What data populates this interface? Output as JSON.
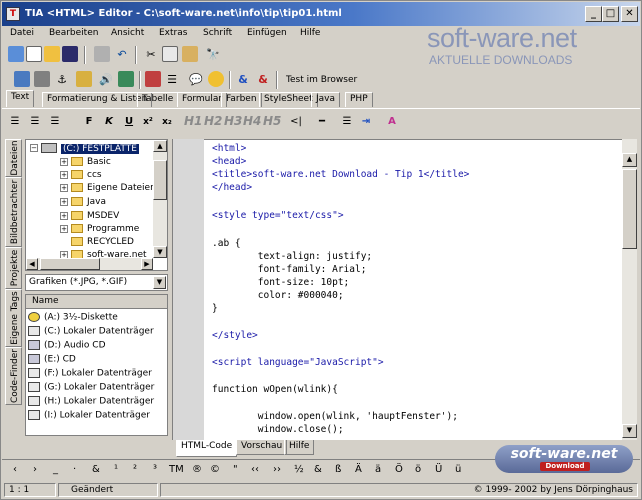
{
  "window": {
    "title": "TIA <HTML> Editor - C:\\soft-ware.net\\info\\tip\\tip01.html",
    "buttons": {
      "min": "_",
      "max": "□",
      "close": "✕"
    }
  },
  "menu": [
    "Datei",
    "Bearbeiten",
    "Ansicht",
    "Extras",
    "Schrift",
    "Einfügen",
    "Hilfe"
  ],
  "logo": {
    "title": "soft-ware.net",
    "subtitle": "AKTUELLE DOWNLOADS"
  },
  "toolbar2": {
    "browser_test_label": "Test im Browser"
  },
  "tabs": [
    "Text",
    "Formatierung & Listen",
    "Tabelle",
    "Formular",
    "Farben",
    "StyleSheet",
    "Java",
    "PHP"
  ],
  "format": {
    "bold": "F",
    "italic": "K",
    "underline": "U",
    "sup": "x²",
    "sub": "x₂",
    "headings": [
      "H1",
      "H2",
      "H3",
      "H4",
      "H5"
    ],
    "lt": "<|"
  },
  "side_tabs": [
    "Dateien",
    "Bildbetrachter",
    "Projekte",
    "Eigene Tags",
    "Code-Finder"
  ],
  "tree": {
    "root": "(C:) FESTPLATTE",
    "items": [
      "Basic",
      "ccs",
      "Eigene Dateien",
      "Java",
      "MSDEV",
      "Programme",
      "RECYCLED",
      "soft-ware.net"
    ]
  },
  "filter": {
    "value": "Grafiken (*.JPG, *.GIF)"
  },
  "files": {
    "header": "Name",
    "rows": [
      "(A:) 3½-Diskette",
      "(C:) Lokaler Datenträger",
      "(D:) Audio CD",
      "(E:) CD",
      "(F:) Lokaler Datenträger",
      "(G:) Lokaler Datenträger",
      "(H:) Lokaler Datenträger",
      "(I:) Lokaler Datenträger"
    ]
  },
  "code": [
    "<html>",
    "<head>",
    "<title>soft-ware.net Download - Tip 1</title>",
    "</head>",
    "",
    "<style type=\"text/css\">",
    "",
    ".ab {",
    "        text-align: justify;",
    "        font-family: Arial;",
    "        font-size: 10pt;",
    "        color: #000040;",
    "}",
    "",
    "</style>",
    "",
    "<script language=\"JavaScript\">",
    "",
    "function wOpen(wlink){",
    "",
    "        window.open(wlink, 'hauptFenster');",
    "        window.close();"
  ],
  "bottom_tabs": [
    "HTML-Code",
    "Vorschau",
    "Hilfe"
  ],
  "chars": [
    "‹",
    "›",
    "_",
    "·",
    "&",
    "¹",
    "²",
    "³",
    "TM",
    "®",
    "©",
    "\"",
    "‹‹",
    "››",
    "½",
    "&",
    "ß",
    "Ä",
    "ä",
    "Ö",
    "ö",
    "Ü",
    "ü"
  ],
  "badge": {
    "title": "soft-ware.net",
    "sub": "Download"
  },
  "status": {
    "pos": "1 : 1",
    "state": "Geändert",
    "copyright": "© 1999- 2002 by Jens Dörpinghaus"
  },
  "colors": {
    "title_start": "#1a3f8a",
    "tag": "#1a1aa8",
    "logo": "#8a96b8"
  }
}
